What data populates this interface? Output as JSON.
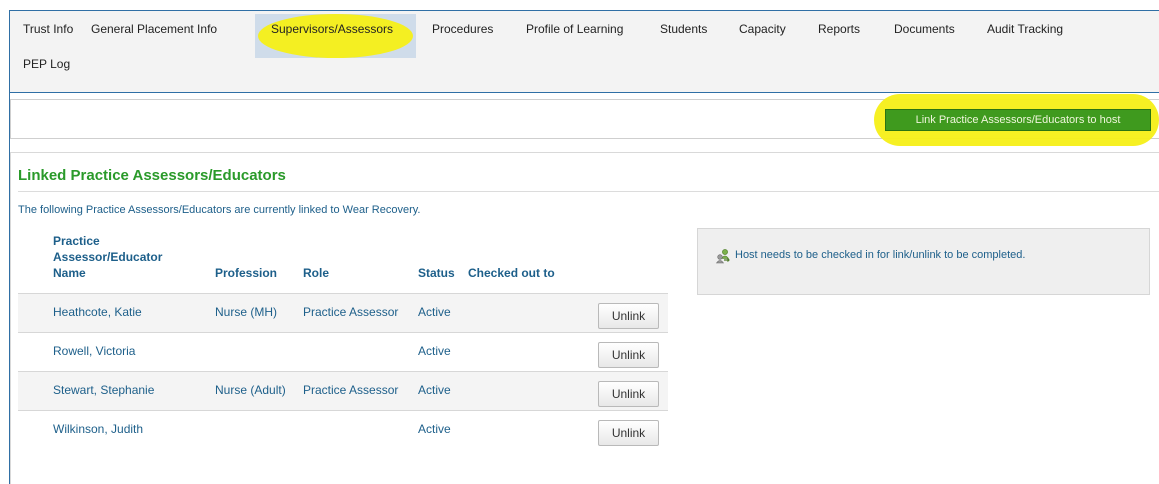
{
  "nav": {
    "tabs_row1": [
      "Trust Info",
      "General Placement Info",
      "Supervisors/Assessors",
      "Procedures",
      "Profile of Learning",
      "Students",
      "Capacity",
      "Reports",
      "Documents",
      "Audit Tracking"
    ],
    "tabs_row2": [
      "PEP Log"
    ],
    "active_tab": "Supervisors/Assessors"
  },
  "toolbar": {
    "link_button_label": "Link Practice Assessors/Educators to host"
  },
  "section": {
    "title": "Linked Practice Assessors/Educators",
    "intro": "The following Practice Assessors/Educators are currently linked to Wear Recovery."
  },
  "table": {
    "headers": {
      "name_line1": "Practice",
      "name_line2": "Assessor/Educator",
      "name_line3": "Name",
      "profession": "Profession",
      "role": "Role",
      "status": "Status",
      "checked_out_to": "Checked out to"
    },
    "rows": [
      {
        "name": "Heathcote, Katie",
        "profession": "Nurse (MH)",
        "role": "Practice Assessor",
        "status": "Active",
        "checked_out_to": "",
        "action": "Unlink"
      },
      {
        "name": "Rowell, Victoria",
        "profession": "",
        "role": "",
        "status": "Active",
        "checked_out_to": "",
        "action": "Unlink"
      },
      {
        "name": "Stewart, Stephanie",
        "profession": "Nurse (Adult)",
        "role": "Practice Assessor",
        "status": "Active",
        "checked_out_to": "",
        "action": "Unlink"
      },
      {
        "name": "Wilkinson, Judith",
        "profession": "",
        "role": "",
        "status": "Active",
        "checked_out_to": "",
        "action": "Unlink"
      }
    ]
  },
  "info": {
    "icon": "link-people-icon",
    "text": "Host needs to be checked in for link/unlink to be completed."
  },
  "colors": {
    "accent_green": "#2a9a2a",
    "button_green": "#3f9a1e",
    "text_blue": "#1d5f8a",
    "highlight_yellow": "#f6ef17"
  }
}
